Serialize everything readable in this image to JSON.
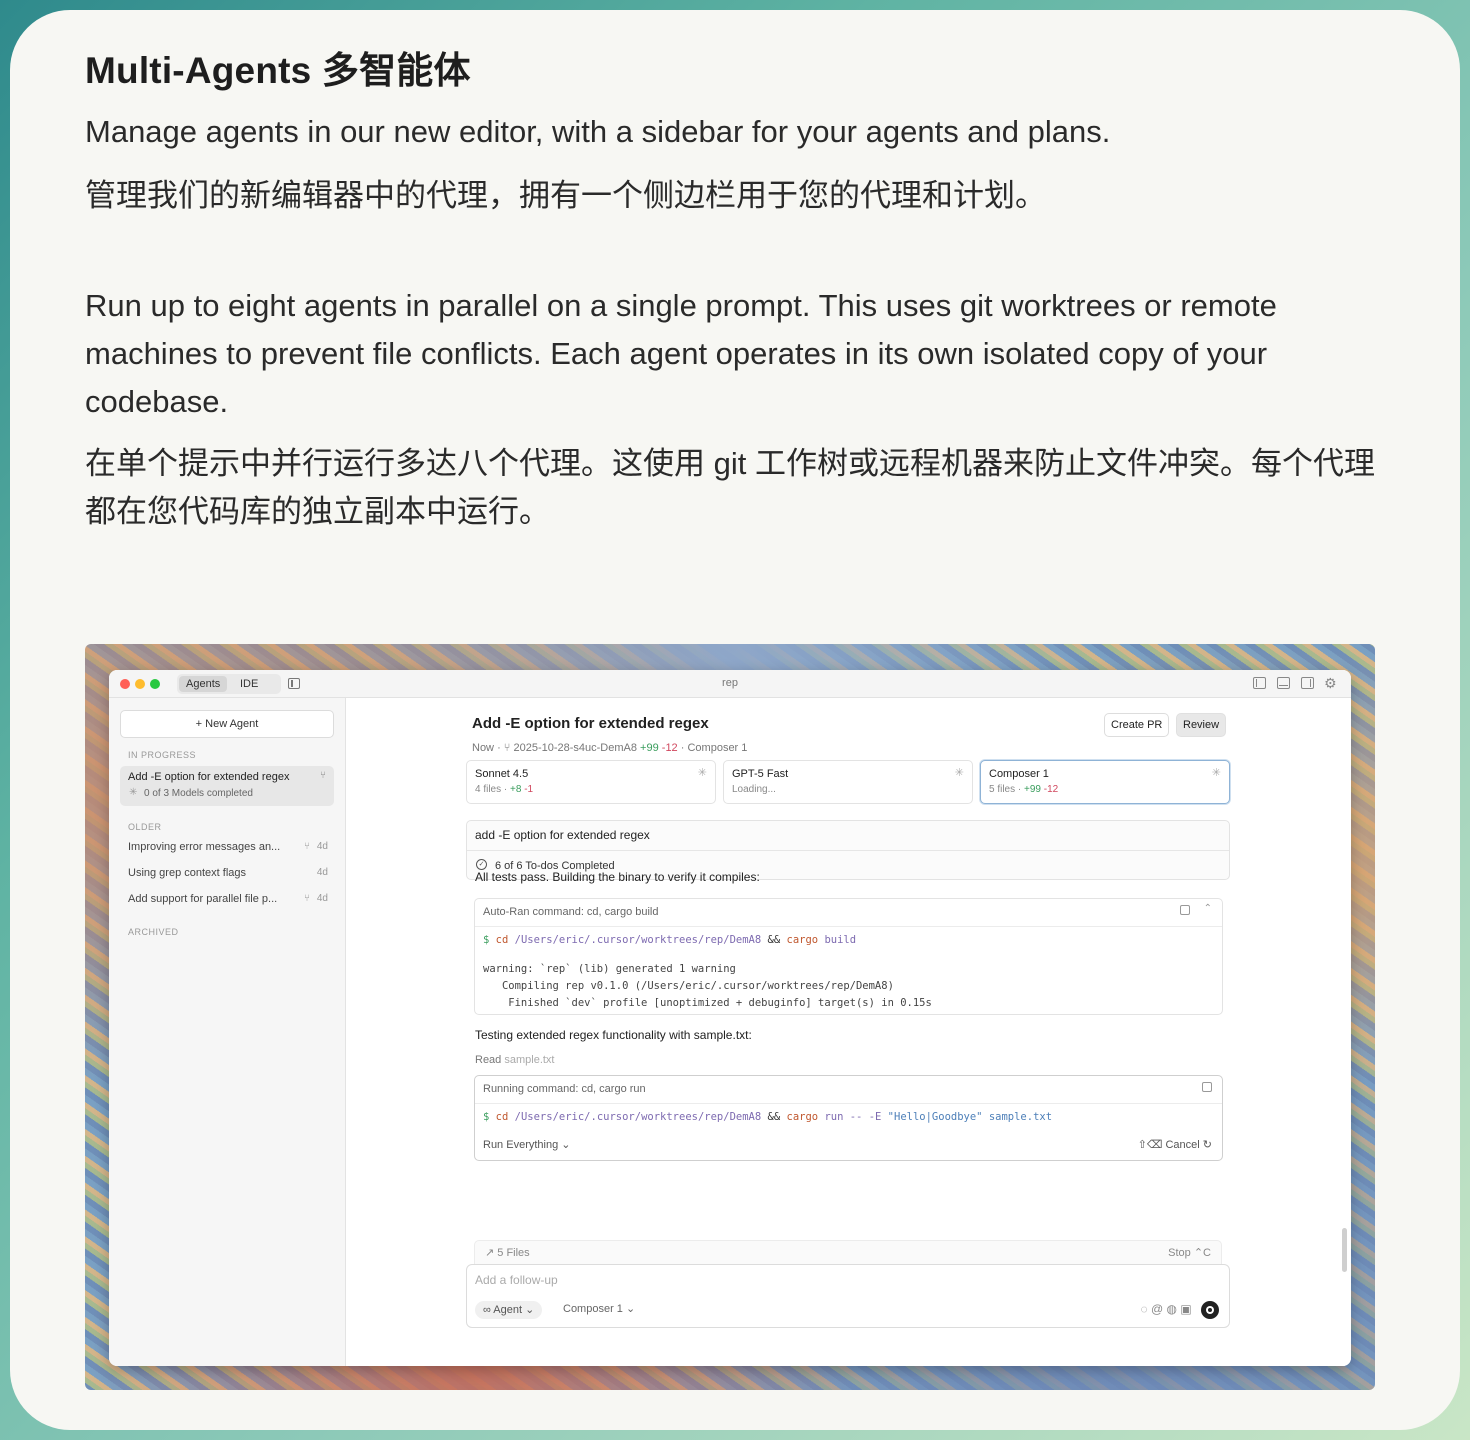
{
  "page": {
    "title": "Multi-Agents  多智能体",
    "para1": "Manage agents in our new editor, with a sidebar for your agents and plans.",
    "para2": "管理我们的新编辑器中的代理，拥有一个侧边栏用于您的代理和计划。",
    "para3": "Run up to eight agents in parallel on a single prompt. This uses git worktrees or remote machines to prevent file conflicts. Each agent operates in its own isolated copy of your codebase.",
    "para4": "在单个提示中并行运行多达八个代理。这使用 git 工作树或远程机器来防止文件冲突。每个代理都在您代码库的独立副本中运行。"
  },
  "window": {
    "tabs": [
      "Agents",
      "IDE"
    ],
    "title": "rep"
  },
  "sidebar": {
    "new_agent": "+  New Agent",
    "in_progress_label": "IN PROGRESS",
    "active_item": {
      "title": "Add -E option for extended regex",
      "status": "0 of 3 Models completed"
    },
    "older_label": "OLDER",
    "older_items": [
      {
        "label": "Improving error messages an...",
        "age": "4d",
        "branch": true
      },
      {
        "label": "Using grep context flags",
        "age": "4d",
        "branch": false
      },
      {
        "label": "Add support for parallel file p...",
        "age": "4d",
        "branch": true
      }
    ],
    "archived_label": "ARCHIVED"
  },
  "main": {
    "title": "Add -E option for extended regex",
    "meta_when": "Now",
    "meta_branch": "2025-10-28-s4uc-DemA8",
    "meta_plus": "+99",
    "meta_minus": "-12",
    "meta_model": "Composer 1",
    "create_pr": "Create PR",
    "review": "Review",
    "models": [
      {
        "name": "Sonnet 4.5",
        "files": "4 files · ",
        "plus": "+8",
        "minus": "-1"
      },
      {
        "name": "GPT-5 Fast",
        "loading": "Loading..."
      },
      {
        "name": "Composer 1",
        "files": "5 files · ",
        "plus": "+99",
        "minus": "-12"
      }
    ],
    "prompt": "add -E option for extended regex",
    "todos": "6 of 6 To-dos Completed",
    "msg1": "All tests pass. Building the binary to verify it compiles:",
    "cmd1": {
      "header": "Auto-Ran command: cd, cargo build",
      "dollar": "$",
      "cd": "cd",
      "path": "/Users/eric/.cursor/worktrees/rep/DemA8",
      "op": "&&",
      "tool": "cargo",
      "sub": "build",
      "output": "warning: `rep` (lib) generated 1 warning\n   Compiling rep v0.1.0 (/Users/eric/.cursor/worktrees/rep/DemA8)\n    Finished `dev` profile [unoptimized + debuginfo] target(s) in 0.15s"
    },
    "msg2": "Testing extended regex functionality with sample.txt:",
    "read_label": "Read",
    "read_file": "sample.txt",
    "cmd2": {
      "header": "Running command: cd, cargo run",
      "dollar": "$",
      "cd": "cd",
      "path": "/Users/eric/.cursor/worktrees/rep/DemA8",
      "op": "&&",
      "tool": "cargo",
      "sub": "run -- -E",
      "arg": "\"Hello|Goodbye\" sample.txt",
      "run_mode": "Run Everything",
      "cancel": "Cancel"
    },
    "files": "5 Files",
    "stop": "Stop",
    "followup_placeholder": "Add a follow-up",
    "agent_mode": "Agent",
    "model_select": "Composer 1"
  }
}
